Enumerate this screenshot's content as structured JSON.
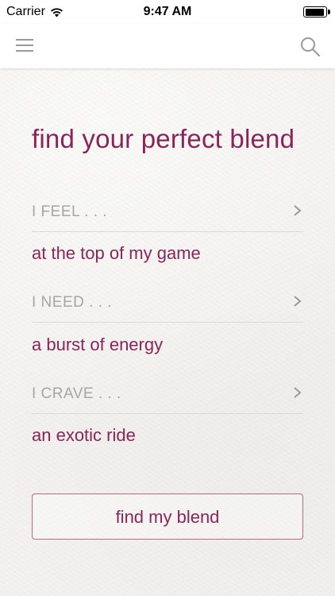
{
  "status_bar": {
    "carrier": "Carrier",
    "time": "9:47 AM",
    "battery_level": 0.95
  },
  "nav": {
    "menu_icon": "hamburger-menu-icon",
    "search_icon": "search-icon"
  },
  "title": "find your perfect blend",
  "questions": [
    {
      "label": "I FEEL . . .",
      "answer": "at the top of my game"
    },
    {
      "label": "I NEED . . .",
      "answer": "a burst of energy"
    },
    {
      "label": "I CRAVE . . .",
      "answer": "an exotic ride"
    }
  ],
  "cta_label": "find my blend",
  "colors": {
    "accent": "#8a2555",
    "label_gray": "#a6a6a6",
    "divider": "#dcdad6",
    "button_border": "#b26b89"
  }
}
